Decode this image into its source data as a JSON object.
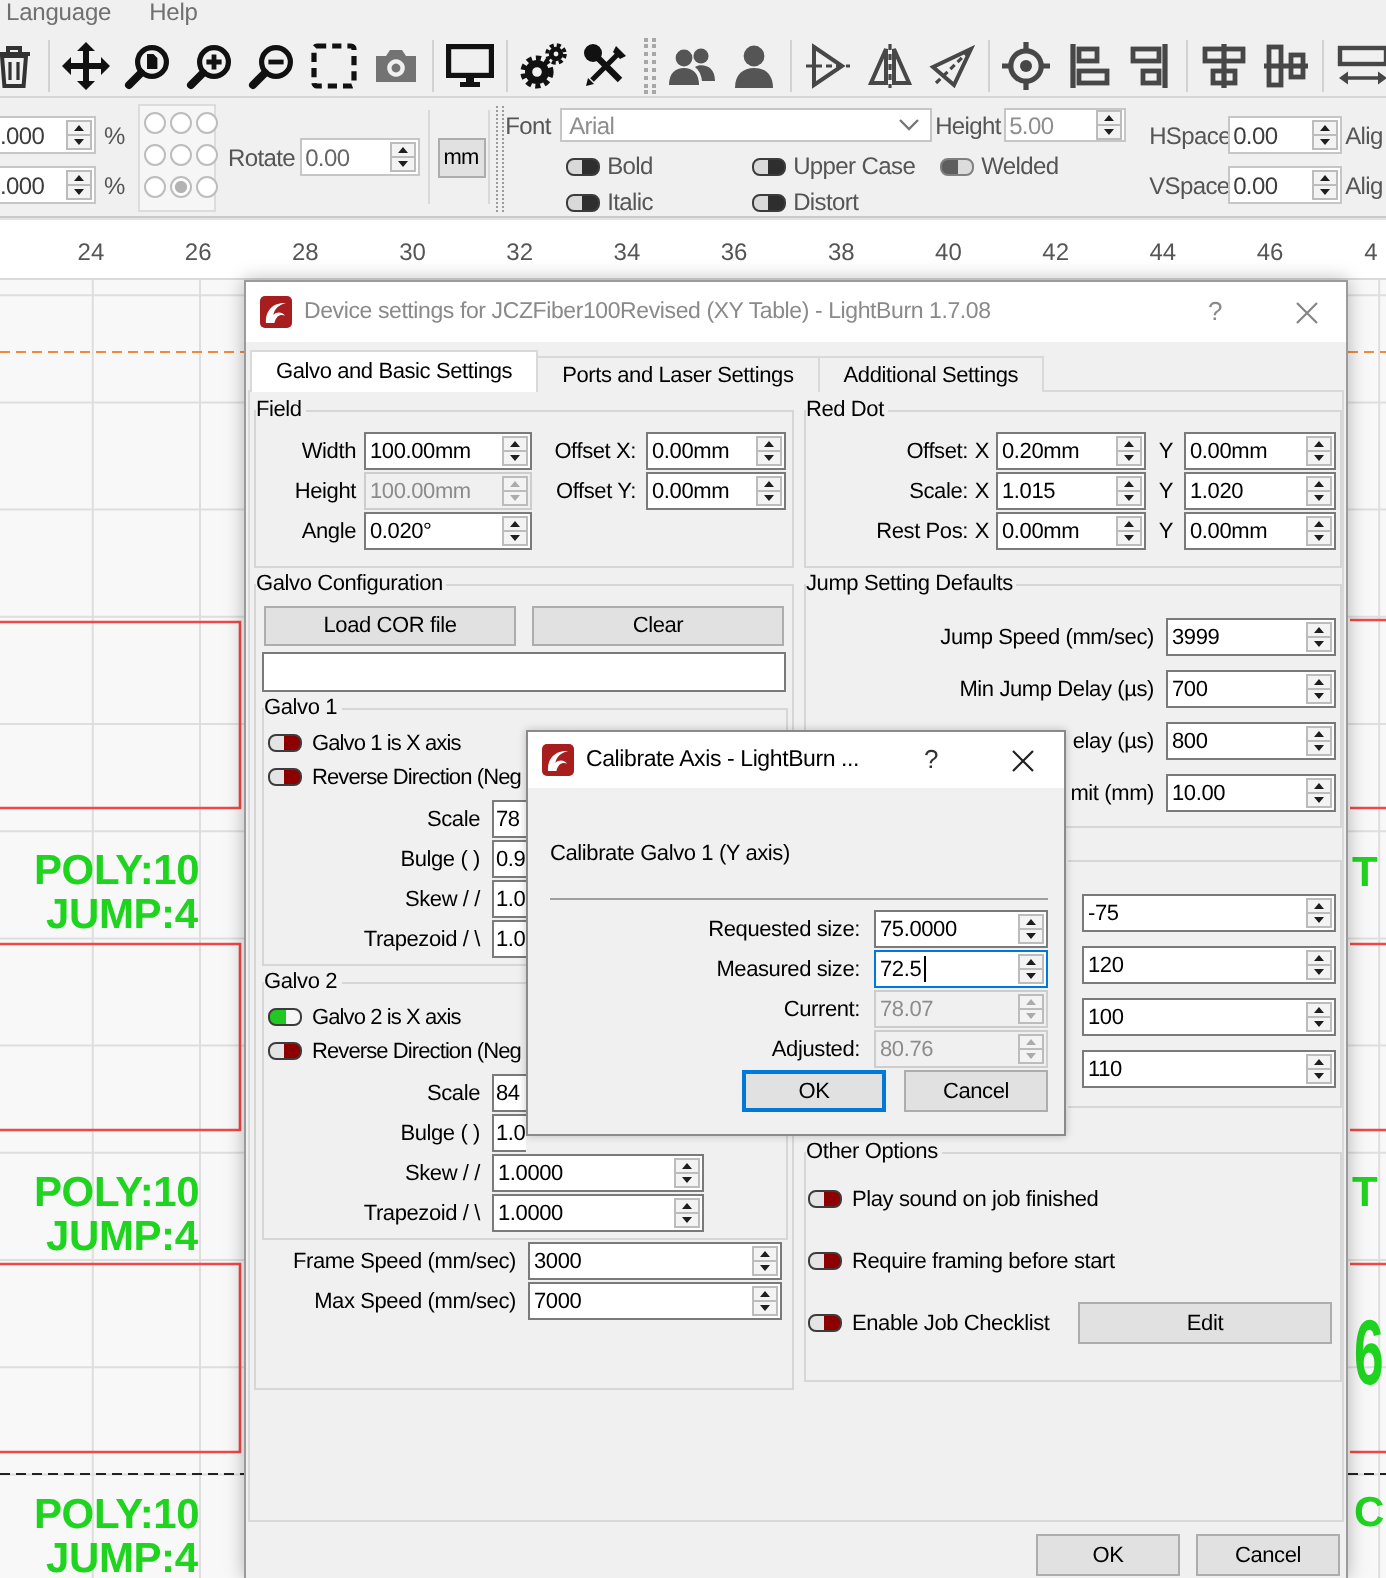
{
  "menu_bar": [
    {
      "label": "Language"
    },
    {
      "label": "Help"
    }
  ],
  "properties_bar": {
    "scale_fields": [
      {
        "value": ".000",
        "unit": "%"
      },
      {
        "value": ".000",
        "unit": "%"
      }
    ],
    "anchors": [
      {
        "selected": false
      },
      {
        "selected": false
      },
      {
        "selected": false
      },
      {
        "selected": false
      },
      {
        "selected": false
      },
      {
        "selected": false
      },
      {
        "selected": false
      },
      {
        "selected": true
      },
      {
        "selected": false
      }
    ],
    "rotate": {
      "label": "Rotate",
      "value": "0.00"
    },
    "unit_button": "mm",
    "text_panel": {
      "disabled": true,
      "font": {
        "label": "Font",
        "value": "Arial"
      },
      "height": {
        "label": "Height",
        "value": "5.00"
      },
      "toggles": [
        {
          "label": "Bold",
          "on": false
        },
        {
          "label": "Upper Case",
          "on": false
        },
        {
          "label": "Welded",
          "on": true
        },
        {
          "label": "Italic",
          "on": false
        },
        {
          "label": "Distort",
          "on": false
        }
      ]
    },
    "spacing": [
      {
        "label": "HSpace",
        "value": "0.00",
        "next_label": "Alig"
      },
      {
        "label": "VSpace",
        "value": "0.00",
        "next_label": "Alig"
      }
    ]
  },
  "ruler": {
    "labels": [
      "24",
      "26",
      "28",
      "30",
      "32",
      "34",
      "36",
      "38",
      "40",
      "42",
      "44",
      "46",
      "4"
    ]
  },
  "canvas": {
    "left_labels": [
      {
        "lines": [
          "POLY:10",
          "JUMP:4"
        ]
      },
      {
        "lines": [
          "POLY:10",
          "JUMP:4"
        ]
      },
      {
        "lines": [
          "POLY:10",
          "JUMP:4"
        ]
      }
    ],
    "right_labels": [
      "T",
      "T",
      "6",
      "C"
    ]
  },
  "device_dialog": {
    "title": "Device settings for JCZFiber100Revised (XY Table) - LightBurn 1.7.08",
    "help_button": "?",
    "tabs": [
      {
        "label": "Galvo and Basic Settings",
        "selected": true
      },
      {
        "label": "Ports and Laser Settings",
        "selected": false
      },
      {
        "label": "Additional Settings",
        "selected": false
      }
    ],
    "field_group": {
      "title": "Field",
      "rows": [
        {
          "label": "Width",
          "value": "100.00mm",
          "disabled": false,
          "offset": {
            "label": "Offset X:",
            "value": "0.00mm"
          }
        },
        {
          "label": "Height",
          "value": "100.00mm",
          "disabled": true,
          "offset": {
            "label": "Offset Y:",
            "value": "0.00mm"
          }
        },
        {
          "label": "Angle",
          "value": "0.020°",
          "disabled": false
        }
      ]
    },
    "red_dot": {
      "title": "Red Dot",
      "rows": [
        {
          "label": "Offset:",
          "x": {
            "label": "X",
            "value": "0.20mm"
          },
          "y": {
            "label": "Y",
            "value": "0.00mm"
          }
        },
        {
          "label": "Scale:",
          "x": {
            "label": "X",
            "value": "1.015"
          },
          "y": {
            "label": "Y",
            "value": "1.020"
          }
        },
        {
          "label": "Rest Pos:",
          "x": {
            "label": "X",
            "value": "0.00mm"
          },
          "y": {
            "label": "Y",
            "value": "0.00mm"
          }
        }
      ]
    },
    "galvo_configuration": {
      "title": "Galvo Configuration",
      "buttons": [
        "Load COR file",
        "Clear"
      ],
      "galvos": [
        {
          "title": "Galvo 1",
          "toggles": [
            {
              "label": "Galvo 1 is X axis",
              "on": false
            },
            {
              "label": "Reverse Direction (Neg",
              "on": false
            }
          ],
          "params": [
            {
              "label": "Scale",
              "value": "78"
            },
            {
              "label": "Bulge ( )",
              "value": "0.9"
            },
            {
              "label": "Skew / /",
              "value": "1.0"
            },
            {
              "label": "Trapezoid / \\",
              "value": "1.0"
            }
          ]
        },
        {
          "title": "Galvo 2",
          "toggles": [
            {
              "label": "Galvo 2 is X axis",
              "on": true
            },
            {
              "label": "Reverse Direction (Neg",
              "on": false
            }
          ],
          "params": [
            {
              "label": "Scale",
              "value": "84"
            },
            {
              "label": "Bulge ( )",
              "value": "1.0"
            },
            {
              "label": "Skew / /",
              "value": "1.0000"
            },
            {
              "label": "Trapezoid / \\",
              "value": "1.0000"
            }
          ]
        }
      ],
      "speeds": [
        {
          "label": "Frame Speed (mm/sec)",
          "value": "3000"
        },
        {
          "label": "Max Speed (mm/sec)",
          "value": "7000"
        }
      ]
    },
    "jump_defaults": {
      "title": "Jump Setting Defaults",
      "rows": [
        {
          "label": "Jump Speed (mm/sec)",
          "value": "3999"
        },
        {
          "label": "Min Jump Delay (µs)",
          "value": "700"
        },
        {
          "label": "elay (µs)",
          "value": "800"
        },
        {
          "label": "mit (mm)",
          "value": "10.00"
        }
      ]
    },
    "untitled_group": {
      "fields": [
        {
          "value": "-75"
        },
        {
          "value": "120"
        },
        {
          "value": "100"
        },
        {
          "value": "110"
        }
      ]
    },
    "other_options": {
      "title": "Other Options",
      "toggles": [
        {
          "label": "Play sound on job finished",
          "on": false
        },
        {
          "label": "Require framing before start",
          "on": false
        },
        {
          "label": "Enable Job Checklist",
          "on": false,
          "button": "Edit"
        }
      ]
    },
    "buttons": [
      "OK",
      "Cancel"
    ]
  },
  "calibrate_dialog": {
    "title": "Calibrate Axis - LightBurn ...",
    "help_button": "?",
    "heading": "Calibrate Galvo 1 (Y axis)",
    "fields": [
      {
        "label": "Requested size:",
        "value": "75.0000",
        "disabled": false,
        "focused": false
      },
      {
        "label": "Measured size:",
        "value": "72.5",
        "disabled": false,
        "focused": true
      },
      {
        "label": "Current:",
        "value": "78.07",
        "disabled": true,
        "focused": false
      },
      {
        "label": "Adjusted:",
        "value": "80.76",
        "disabled": true,
        "focused": false
      }
    ],
    "buttons": [
      {
        "label": "OK",
        "focused": true
      },
      {
        "label": "Cancel",
        "focused": false
      }
    ]
  }
}
